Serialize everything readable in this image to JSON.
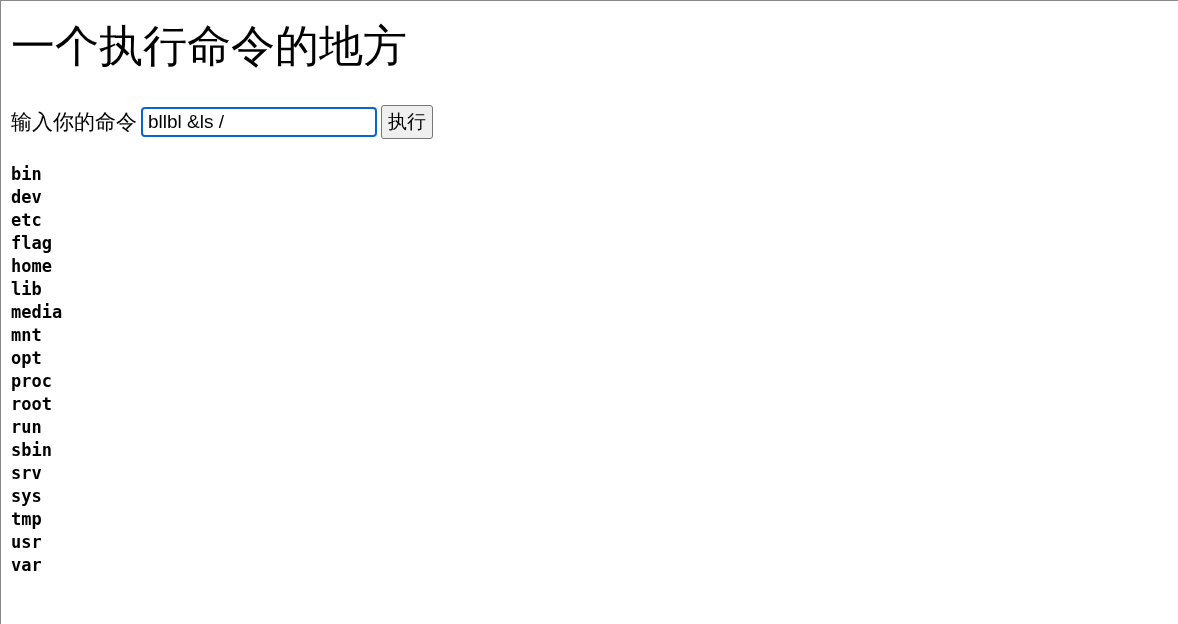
{
  "heading": "一个执行命令的地方",
  "form": {
    "label": "输入你的命令",
    "input": {
      "value": "bllbl &ls /",
      "focused": true
    },
    "button": "执行"
  },
  "output": [
    "bin",
    "dev",
    "etc",
    "flag",
    "home",
    "lib",
    "media",
    "mnt",
    "opt",
    "proc",
    "root",
    "run",
    "sbin",
    "srv",
    "sys",
    "tmp",
    "usr",
    "var"
  ]
}
